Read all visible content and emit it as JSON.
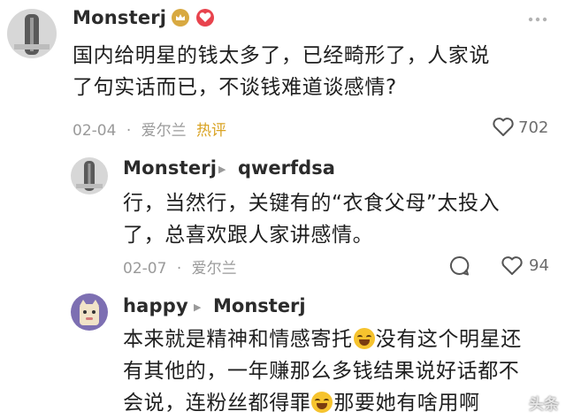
{
  "comments": [
    {
      "username": "Monsterj",
      "text_line1": "国内给明星的钱太多了，已经畸形了，人家说",
      "text_line2": "了句实话而已，不谈钱难道谈感情?",
      "date": "02-04",
      "location": "爱尔兰",
      "tag": "热评",
      "likes": "702"
    },
    {
      "username": "Monsterj",
      "reply_to": "qwerfdsa",
      "text_line1": "行，当然行，关键有的“衣食父母”太投入",
      "text_line2": "了，总喜欢跟人家讲感情。",
      "date": "02-07",
      "location": "爱尔兰",
      "likes": "94"
    },
    {
      "username": "happy",
      "reply_to": "Monsterj",
      "text_line1a": "本来就是精神和情感寄托",
      "text_line1b": "没有这个明星还",
      "text_line2": "有其他的，一年赚那么多钱结果说好话都不",
      "text_line3a": "会说，连粉丝都得罪",
      "text_line3b": "那要她有啥用啊"
    }
  ],
  "separator": "·",
  "watermark": "头条",
  "icons": {
    "more": "more-icon",
    "reply": "comment-icon",
    "like": "heart-icon",
    "vip": "crown-badge-icon",
    "level": "level-badge-icon",
    "emoji": "laughing-tears-emoji"
  },
  "colors": {
    "hot": "#d9a323",
    "meta": "#9a9a9a",
    "badge_red": "#e8434d",
    "badge_gold": "#d8a941"
  }
}
